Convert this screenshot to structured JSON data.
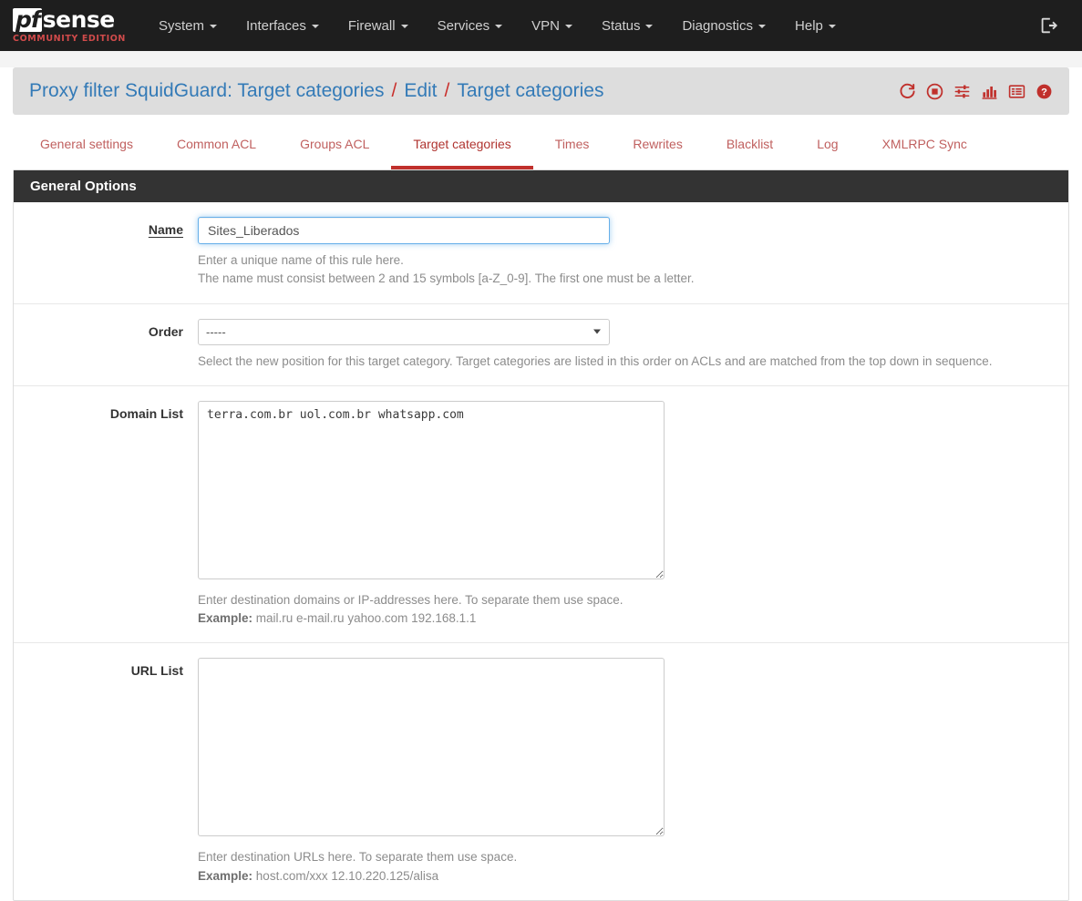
{
  "navbar": {
    "brand": {
      "pf": "pf",
      "sense": "sense",
      "sub": "COMMUNITY EDITION"
    },
    "items": [
      {
        "label": "System",
        "has_caret": true
      },
      {
        "label": "Interfaces",
        "has_caret": true
      },
      {
        "label": "Firewall",
        "has_caret": true
      },
      {
        "label": "Services",
        "has_caret": true
      },
      {
        "label": "VPN",
        "has_caret": true
      },
      {
        "label": "Status",
        "has_caret": true
      },
      {
        "label": "Diagnostics",
        "has_caret": true
      },
      {
        "label": "Help",
        "has_caret": true
      }
    ],
    "logout_icon": "logout-icon"
  },
  "header": {
    "breadcrumb": [
      {
        "text": "Proxy filter SquidGuard: Target categories",
        "link": true
      },
      {
        "text": "/",
        "sep": true
      },
      {
        "text": "Edit",
        "link": true
      },
      {
        "text": "/",
        "sep": true
      },
      {
        "text": "Target categories",
        "link": true
      }
    ],
    "icons": [
      {
        "name": "restart-icon",
        "title": "Restart"
      },
      {
        "name": "stop-icon",
        "title": "Stop"
      },
      {
        "name": "sliders-icon",
        "title": "Settings"
      },
      {
        "name": "bar-chart-icon",
        "title": "Statistics"
      },
      {
        "name": "log-list-icon",
        "title": "Log"
      },
      {
        "name": "help-circle-icon",
        "title": "Help"
      }
    ],
    "accent_red": "#c0302c",
    "link_blue": "#337ab7"
  },
  "tabs": [
    {
      "label": "General settings",
      "active": false
    },
    {
      "label": "Common ACL",
      "active": false
    },
    {
      "label": "Groups ACL",
      "active": false
    },
    {
      "label": "Target categories",
      "active": true
    },
    {
      "label": "Times",
      "active": false
    },
    {
      "label": "Rewrites",
      "active": false
    },
    {
      "label": "Blacklist",
      "active": false
    },
    {
      "label": "Log",
      "active": false
    },
    {
      "label": "XMLRPC Sync",
      "active": false
    }
  ],
  "panel": {
    "title": "General Options",
    "fields": {
      "name": {
        "label": "Name",
        "value": "Sites_Liberados",
        "placeholder": "",
        "help_line1": "Enter a unique name of this rule here.",
        "help_line2": "The name must consist between 2 and 15 symbols [a-Z_0-9]. The first one must be a letter."
      },
      "order": {
        "label": "Order",
        "selected": "-----",
        "options": [
          "-----"
        ],
        "help_line1": "Select the new position for this target category. Target categories are listed in this order on ACLs and are matched from the top down in sequence."
      },
      "domain_list": {
        "label": "Domain List",
        "value": "terra.com.br uol.com.br whatsapp.com",
        "placeholder": "",
        "help_line1": "Enter destination domains or IP-addresses here. To separate them use space.",
        "help_example_label": "Example:",
        "help_example_value": "mail.ru e-mail.ru yahoo.com 192.168.1.1"
      },
      "url_list": {
        "label": "URL List",
        "value": "",
        "placeholder": "",
        "help_line1": "Enter destination URLs here. To separate them use space.",
        "help_example_label": "Example:",
        "help_example_value": "host.com/xxx 12.10.220.125/alisa"
      }
    }
  }
}
